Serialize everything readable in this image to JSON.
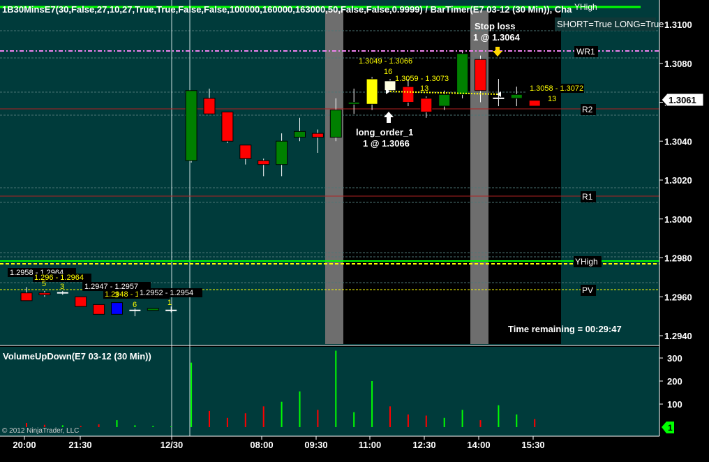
{
  "colors": {
    "background": "#003b3b",
    "session_band": "#000000",
    "gray_band": "#6e6e6e",
    "up_candle": "#008000",
    "down_candle": "#ff0000",
    "flat_candle": "#ffffe0",
    "blue_candle": "#0000ff",
    "yellow_text": "#ffff00",
    "pivot_line": "#b22222",
    "green_line": "#00ff00",
    "pink_line": "#ee82ee",
    "pv_line": "#ffff00",
    "vol_up": "#00ff00",
    "vol_down": "#ff0000"
  },
  "header": {
    "indicator_title": "1B30MinsE7(30,False,27,10,27,True,True,False,False,100000,160000,163000,50,False,False,0.9999)  /  BarTimer(E7  03-12  (30  Min)),  Cha",
    "yhigh_top": "YHigh"
  },
  "status": {
    "short_long": "SHORT=True LONG=True",
    "time_remaining": "Time remaining = 00:29:47",
    "copyright": "© 2012 NinjaTrader, LLC"
  },
  "orders": {
    "stop_loss_label": "Stop loss",
    "stop_loss_fill": "1 @ 1.3064",
    "long_order_label": "long_order_1",
    "long_order_fill": "1 @ 1.3066"
  },
  "levels": {
    "wr1": "WR1",
    "r2": "R2",
    "r1": "R1",
    "yhigh": "YHigh",
    "pv": "PV"
  },
  "price_axis": {
    "ticks": [
      "1.3100",
      "1.3080",
      "1.3060",
      "1.3040",
      "1.3020",
      "1.3000",
      "1.2980",
      "1.2960",
      "1.2940"
    ],
    "current_price": "1.3061"
  },
  "volume_panel": {
    "title": "VolumeUpDown(E7 03-12 (30 Min))",
    "ticks": [
      "300",
      "200",
      "100"
    ],
    "marker": "1"
  },
  "time_axis": {
    "labels": [
      "20:00",
      "21:30",
      "12/30",
      "08:00",
      "09:30",
      "11:00",
      "12:30",
      "14:00",
      "15:30"
    ]
  },
  "range_labels": [
    {
      "text": "1.2958 - 1.2964",
      "color": "#ffffff"
    },
    {
      "text": "1.296 - 1.2964",
      "color": "#ffff00"
    },
    {
      "text": "1.2947 - 1.2957",
      "color": "#ffffff"
    },
    {
      "text": "1.2948 - 1.2952",
      "color": "#ffff00"
    },
    {
      "text": "1.2952 - 1.2954",
      "color": "#ffffff"
    },
    {
      "text": "1.3049 - 1.3066",
      "color": "#ffff00"
    },
    {
      "text": "1.3059 - 1.3073",
      "color": "#ffff00"
    },
    {
      "text": "1.3058 - 1.3072",
      "color": "#ffff00"
    }
  ],
  "count_labels": [
    "5",
    "3",
    "3",
    "6",
    "1",
    "16",
    "13",
    "13"
  ],
  "chart_data": {
    "type": "candlestick",
    "instrument": "E7 03-12 (30 Min)",
    "candles": [
      {
        "o": 1.2962,
        "h": 1.2965,
        "l": 1.2958,
        "c": 1.2958
      },
      {
        "o": 1.2962,
        "h": 1.2963,
        "l": 1.296,
        "c": 1.2961
      },
      {
        "o": 1.2962,
        "h": 1.2963,
        "l": 1.2961,
        "c": 1.2962
      },
      {
        "o": 1.296,
        "h": 1.296,
        "l": 1.2955,
        "c": 1.2955
      },
      {
        "o": 1.2956,
        "h": 1.2956,
        "l": 1.2951,
        "c": 1.2951
      },
      {
        "o": 1.2951,
        "h": 1.2957,
        "l": 1.2951,
        "c": 1.2957
      },
      {
        "o": 1.2953,
        "h": 1.2954,
        "l": 1.295,
        "c": 1.2953
      },
      {
        "o": 1.2953,
        "h": 1.2954,
        "l": 1.2953,
        "c": 1.2954
      },
      {
        "o": 1.2953,
        "h": 1.2955,
        "l": 1.2952,
        "c": 1.2953
      },
      {
        "o": 1.303,
        "h": 1.3066,
        "l": 1.3029,
        "c": 1.3066
      },
      {
        "o": 1.3062,
        "h": 1.3067,
        "l": 1.3055,
        "c": 1.3054
      },
      {
        "o": 1.3055,
        "h": 1.3055,
        "l": 1.3039,
        "c": 1.304
      },
      {
        "o": 1.3038,
        "h": 1.3038,
        "l": 1.3028,
        "c": 1.3031
      },
      {
        "o": 1.303,
        "h": 1.3031,
        "l": 1.3022,
        "c": 1.3028
      },
      {
        "o": 1.3028,
        "h": 1.3044,
        "l": 1.3022,
        "c": 1.304
      },
      {
        "o": 1.3042,
        "h": 1.3052,
        "l": 1.304,
        "c": 1.3045
      },
      {
        "o": 1.3044,
        "h": 1.3046,
        "l": 1.3034,
        "c": 1.3042
      },
      {
        "o": 1.3042,
        "h": 1.3062,
        "l": 1.304,
        "c": 1.3056
      },
      {
        "o": 1.3059,
        "h": 1.3067,
        "l": 1.3054,
        "c": 1.306
      },
      {
        "o": 1.3059,
        "h": 1.3073,
        "l": 1.3056,
        "c": 1.3072
      },
      {
        "o": 1.3071,
        "h": 1.3072,
        "l": 1.3066,
        "c": 1.3066
      },
      {
        "o": 1.3068,
        "h": 1.3072,
        "l": 1.3058,
        "c": 1.306
      },
      {
        "o": 1.3062,
        "h": 1.3063,
        "l": 1.3052,
        "c": 1.3055
      },
      {
        "o": 1.3058,
        "h": 1.3066,
        "l": 1.3056,
        "c": 1.3064
      },
      {
        "o": 1.3064,
        "h": 1.3086,
        "l": 1.3062,
        "c": 1.3085
      },
      {
        "o": 1.3082,
        "h": 1.3084,
        "l": 1.306,
        "c": 1.3066
      },
      {
        "o": 1.3062,
        "h": 1.3072,
        "l": 1.3058,
        "c": 1.3062
      },
      {
        "o": 1.3062,
        "h": 1.3068,
        "l": 1.3058,
        "c": 1.3064
      },
      {
        "o": 1.3061,
        "h": 1.3061,
        "l": 1.3058,
        "c": 1.3058
      }
    ],
    "volume": [
      18,
      10,
      8,
      5,
      12,
      30,
      8,
      5,
      3,
      280,
      70,
      40,
      60,
      90,
      110,
      155,
      75,
      332,
      65,
      200,
      90,
      55,
      50,
      40,
      75,
      30,
      95,
      55,
      35
    ],
    "price_range": [
      1.294,
      1.311
    ],
    "volume_range": [
      0,
      340
    ]
  }
}
